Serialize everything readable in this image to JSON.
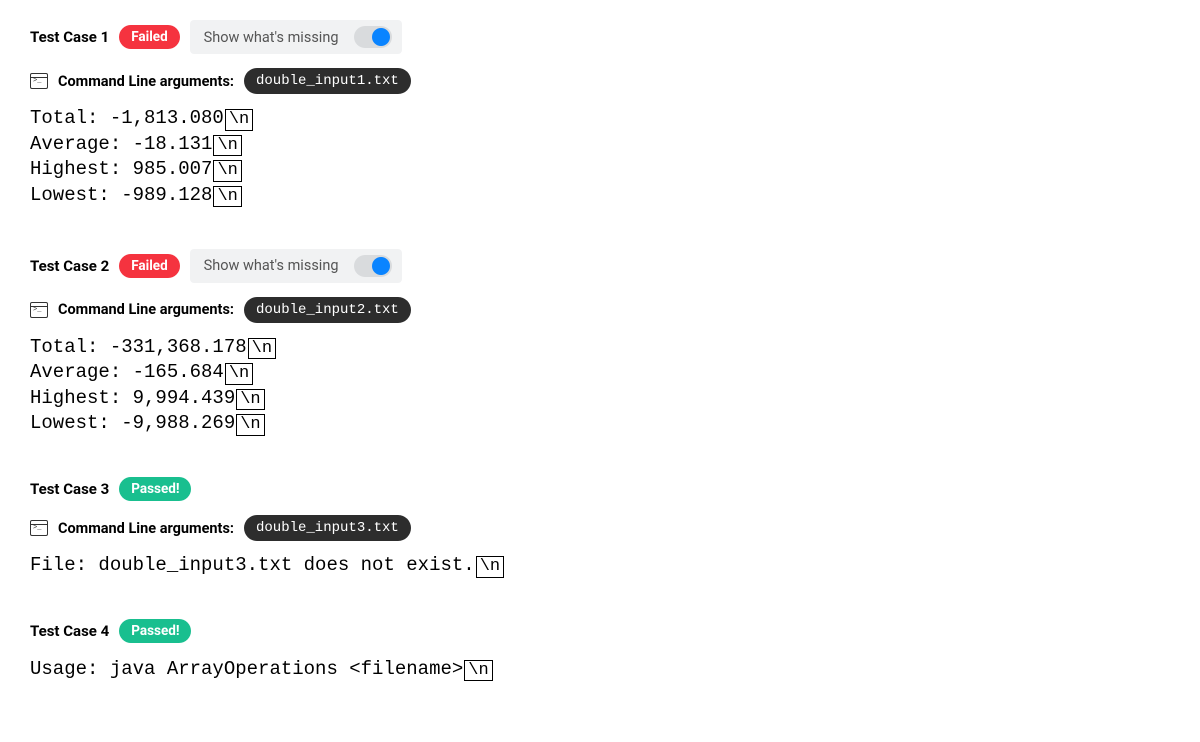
{
  "newline_symbol": "\\n",
  "labels": {
    "command_line": "Command Line arguments:",
    "show_missing": "Show what's missing"
  },
  "testcases": [
    {
      "title": "Test Case 1",
      "status": "Failed",
      "status_kind": "failed",
      "show_missing": true,
      "argument": "double_input1.txt",
      "output": [
        "Total: -1,813.080",
        "Average: -18.131",
        "Highest: 985.007",
        "Lowest: -989.128"
      ]
    },
    {
      "title": "Test Case 2",
      "status": "Failed",
      "status_kind": "failed",
      "show_missing": true,
      "argument": "double_input2.txt",
      "output": [
        "Total: -331,368.178",
        "Average: -165.684",
        "Highest: 9,994.439",
        "Lowest: -9,988.269"
      ]
    },
    {
      "title": "Test Case 3",
      "status": "Passed!",
      "status_kind": "passed",
      "show_missing": false,
      "argument": "double_input3.txt",
      "output": [
        "File: double_input3.txt does not exist."
      ]
    },
    {
      "title": "Test Case 4",
      "status": "Passed!",
      "status_kind": "passed",
      "show_missing": false,
      "argument": null,
      "output": [
        "Usage: java ArrayOperations <filename>"
      ]
    }
  ]
}
